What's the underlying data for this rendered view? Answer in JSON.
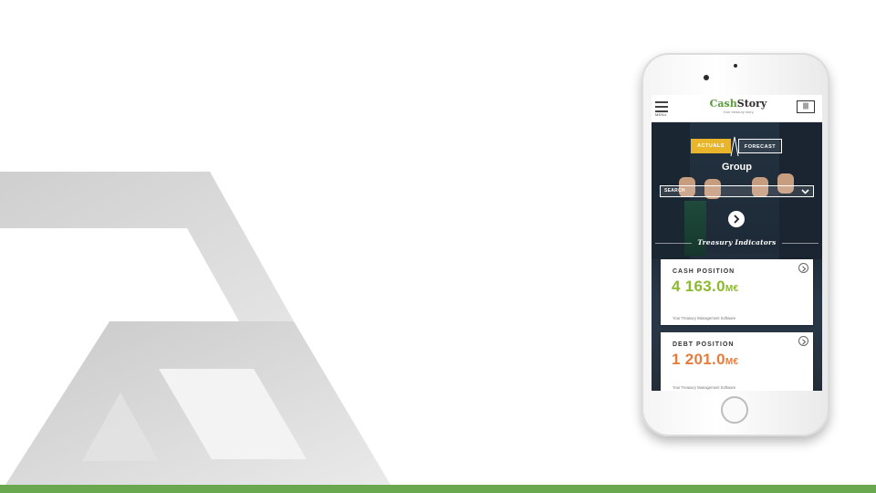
{
  "colors": {
    "brand_green": "#69a84f",
    "actuals_yellow": "#e9b52a",
    "cash_value": "#8cb92e",
    "debt_value": "#e67c3c"
  },
  "app": {
    "menu_label": "MENU",
    "brand_first": "Cash",
    "brand_second": "Story",
    "brand_tagline": "Your treasury story",
    "grid_icon": "columns-icon"
  },
  "hero": {
    "toggle_actuals": "ACTUALS",
    "toggle_forecast": "FORECAST",
    "entity": "Group",
    "search_label": "SEARCH",
    "section_title": "Treasury Indicators"
  },
  "cards": [
    {
      "title": "CASH POSITION",
      "value": "4 163.0",
      "unit": "M€",
      "subtitle": "Your Treasury Management Software"
    },
    {
      "title": "DEBT POSITION",
      "value": "1 201.0",
      "unit": "M€",
      "subtitle": "Your Treasury Management Software"
    }
  ]
}
